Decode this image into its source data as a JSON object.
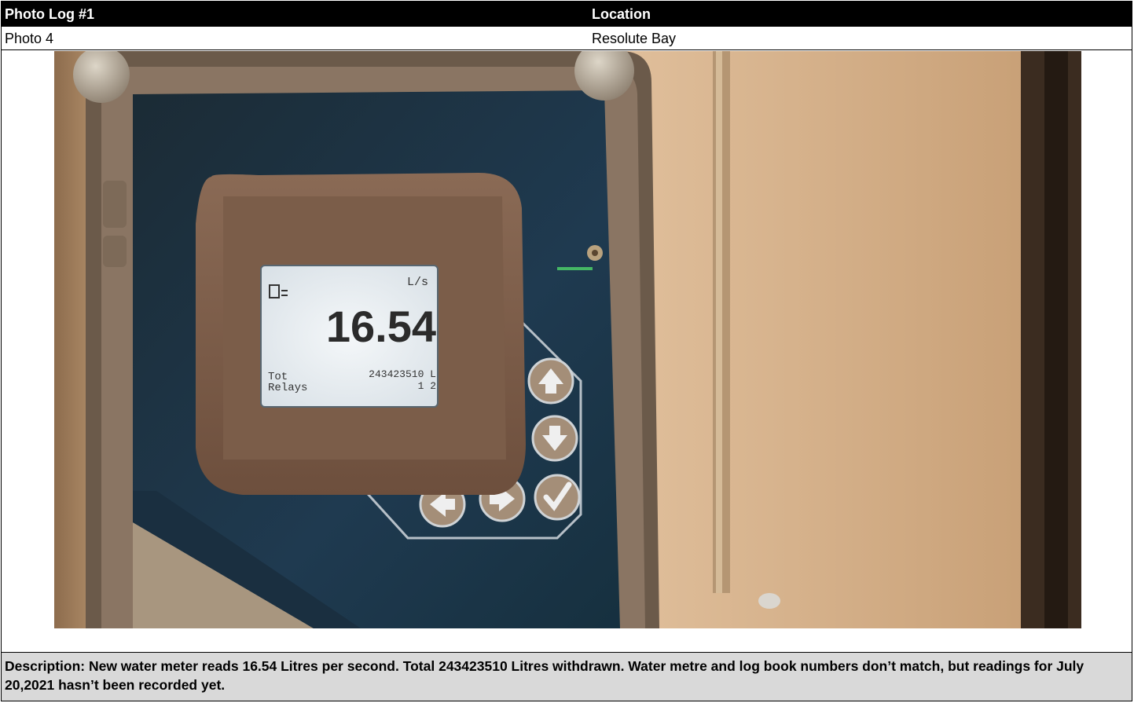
{
  "header": {
    "photo_log_label": "Photo Log #1",
    "location_label": "Location"
  },
  "row": {
    "photo_number": "Photo 4",
    "location_value": "Resolute Bay"
  },
  "meter_display": {
    "unit": "L/s",
    "flow_value": "16.54",
    "total_label": "Tot",
    "total_value": "243423510 L",
    "relays_label": "Relays",
    "relays_value": "1 2"
  },
  "description": "Description: New water meter reads 16.54 Litres per second. Total 243423510 Litres withdrawn.  Water metre and log book numbers don’t match, but readings for July 20,2021 hasn’t been recorded yet.",
  "colors": {
    "header_bg": "#000000",
    "description_bg": "#d9d9d9",
    "wall": "#d9b48a",
    "panel": "#1c3447",
    "bezel": "#7a5a45",
    "lcd": "#e9eef2"
  },
  "icons": [
    "up-arrow-button",
    "down-arrow-button",
    "left-arrow-button",
    "right-arrow-button",
    "check-button"
  ]
}
